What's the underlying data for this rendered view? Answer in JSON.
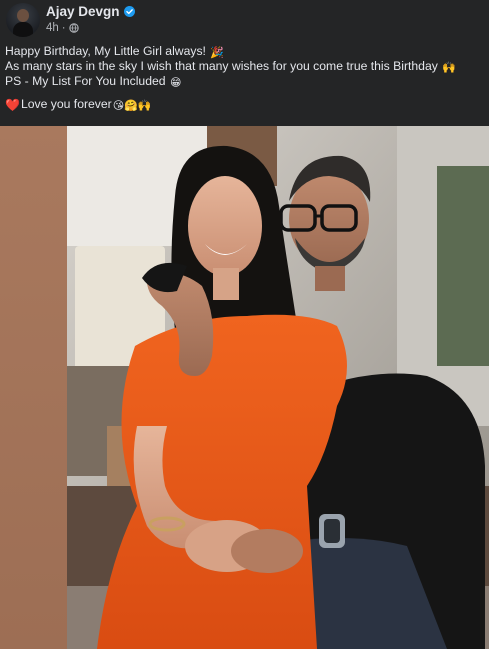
{
  "post": {
    "author": {
      "name": "Ajay Devgn",
      "verified": true,
      "avatar_icon": "profile-avatar"
    },
    "meta": {
      "time": "4h",
      "separator": "·",
      "privacy_icon": "globe-icon"
    },
    "caption": {
      "line1": "Happy Birthday, My Little Girl always!",
      "line1_emoji": "🎉",
      "line2": "As many stars in the sky I wish that many wishes for you come true this Birthday",
      "line2_emoji": "🙌",
      "line3": "PS - My List For You Included",
      "line3_emoji": "😁",
      "line4_heart": "❤️",
      "line4": "Love you forever",
      "line4_emoji": "😘🤗🙌"
    },
    "media": {
      "type": "photo"
    }
  },
  "colors": {
    "background": "#242526",
    "primary_text": "#e4e6eb",
    "secondary_text": "#b0b3b8",
    "verified_badge": "#1d9bf0",
    "side_strip": "#a5765c"
  }
}
